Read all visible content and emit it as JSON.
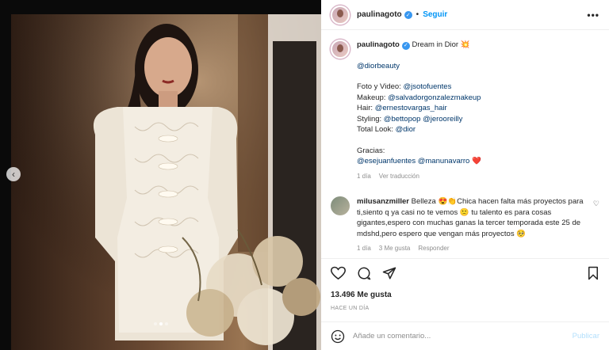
{
  "post": {
    "username": "paulinagoto",
    "follow_label": "Seguir",
    "separator": "•"
  },
  "caption": {
    "username": "paulinagoto",
    "text": "Dream in Dior 💥",
    "mention": "@diorbeauty",
    "credits": [
      {
        "label": "Foto y Video: ",
        "handle": "@jsotofuentes"
      },
      {
        "label": "Makeup: ",
        "handle": "@salvadorgonzalezmakeup"
      },
      {
        "label": "Hair: ",
        "handle": "@ernestovargas_hair"
      },
      {
        "label": "Styling: ",
        "handle": "@bettopop",
        "handle2": "@jerooreilly"
      },
      {
        "label": "Total Look: ",
        "handle": "@dior"
      }
    ],
    "thanks_label": "Gracias:",
    "thanks_handles": "@esejuanfuentes @manunavarro",
    "thanks_emoji": "❤️",
    "time": "1 día",
    "translate": "Ver traducción"
  },
  "comment": {
    "username": "milusanzmiller",
    "text": "Belleza 😍👏Chica hacen falta más proyectos para ti,siento q ya casi no te vemos 🙁 tu talento es para cosas gigantes,espero con muchas ganas la tercer temporada este 25 de mdshd,pero espero que vengan más proyectos 🥺",
    "time": "1 día",
    "likes": "3 Me gusta",
    "reply": "Responder"
  },
  "stats": {
    "likes": "13.496 Me gusta",
    "posted": "HACE UN DÍA"
  },
  "composer": {
    "placeholder": "Añade un comentario...",
    "publish": "Publicar"
  },
  "carousel": {
    "slides": 3,
    "active": 1
  },
  "icons": [
    "chevron-left-icon",
    "verified-icon",
    "more-icon",
    "heart-icon",
    "comment-icon",
    "share-icon",
    "bookmark-icon",
    "emoji-icon"
  ]
}
